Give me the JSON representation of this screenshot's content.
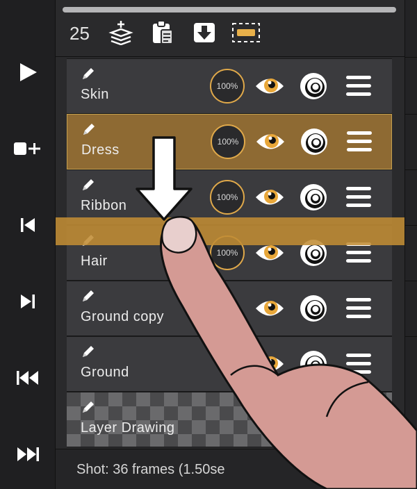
{
  "toolbar": {
    "frame_count": "25",
    "tools": [
      "add-layer-icon",
      "clipboard-icon",
      "import-icon",
      "selection-icon"
    ]
  },
  "transport": [
    "play-icon",
    "add-frame-icon",
    "previous-frame-icon",
    "next-frame-icon",
    "first-frame-icon",
    "last-frame-icon"
  ],
  "layers": [
    {
      "name": "Skin",
      "opacity": "100%"
    },
    {
      "name": "Dress",
      "opacity": "100%",
      "selected": true
    },
    {
      "name": "Ribbon",
      "opacity": "100%"
    },
    {
      "name": "Hair",
      "opacity": "100%"
    },
    {
      "name": "Ground copy"
    },
    {
      "name": "Ground"
    },
    {
      "name": "Layer Drawing",
      "locked": true
    }
  ],
  "footer": {
    "shot_info": "Shot: 36 frames (1.50se"
  },
  "colors": {
    "accent": "#e0a94a",
    "selected_row": "#8e6a33",
    "drop_band": "#c08c34",
    "finger": "#d49a94"
  }
}
